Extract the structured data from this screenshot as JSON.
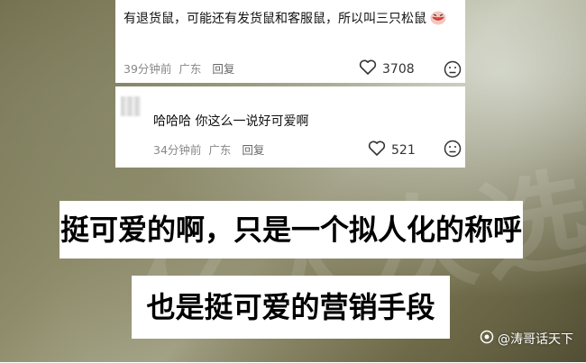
{
  "comment1": {
    "text": "有退货鼠，可能还有发货鼠和客服鼠，所以叫三只松鼠",
    "emoji": "laughing-face-emoji",
    "time": "39分钟前",
    "location": "广东",
    "reply_label": "回复",
    "likes": "3708"
  },
  "comment2": {
    "text": "哈哈哈 你这么一说好可爱啊",
    "time": "34分钟前",
    "location": "广东",
    "reply_label": "回复",
    "likes": "521"
  },
  "captions": {
    "line1": "挺可爱的啊，只是一个拟人化的称呼",
    "line2": "也是挺可爱的营销手段"
  },
  "watermark": {
    "handle": "@涛哥话天下",
    "icon": "camera-lens-icon"
  },
  "background_text": "亿人次选择",
  "colors": {
    "meta": "#888888",
    "card_bg": "#ffffff",
    "caption_bg": "#ffffff"
  }
}
